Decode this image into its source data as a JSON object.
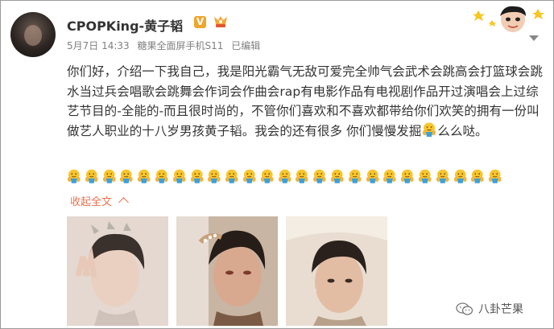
{
  "post": {
    "username": "CPOPKing-黄子韬",
    "verified_badge": "V",
    "date": "5月7日 14:33",
    "device": "糖果全面屏手机S11",
    "edited": "已编辑",
    "text_part1": "你们好，介绍一下我自己，我是阳光霸气无敌可爱完全帅气会武术会跳高会打篮球会跳水当过兵会唱歌会跳舞会作词会作曲会rap有电影作品有电视剧作品开过演唱会上过综艺节目的-全能的-而且很时尚的，不管你们喜欢和不喜欢都带给你们欢笑的拥有一份叫做艺人职业的十八岁男孩黄子韬。我会的还有很多 你们慢慢发掘",
    "text_part2": "么么哒。",
    "emoji_name": "hug-emoji",
    "emoji_row_count": 25,
    "collapse_label": "收起全文",
    "photos": [
      "photo-1",
      "photo-2",
      "photo-3"
    ]
  },
  "watermark": {
    "text": "八卦芒果",
    "icon": "wechat-icon"
  },
  "colors": {
    "accent": "#eb7350",
    "meta_text": "#808080",
    "verified": "#f0a52b"
  }
}
